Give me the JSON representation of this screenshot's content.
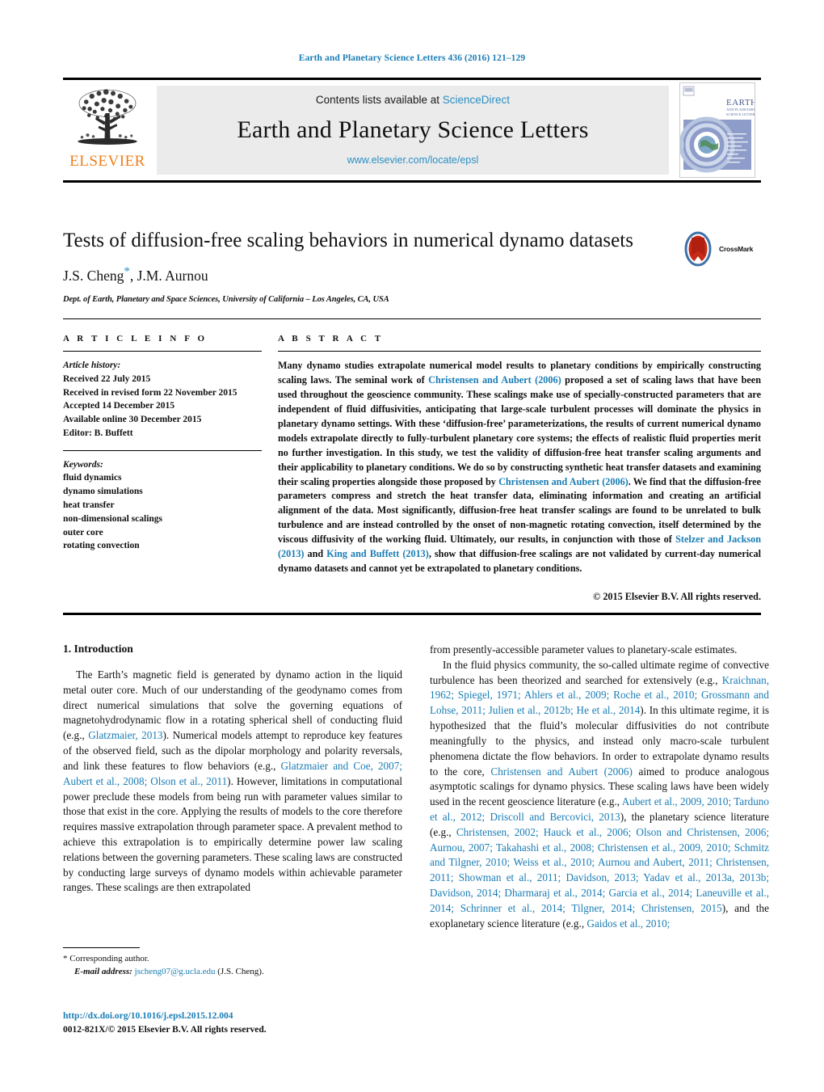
{
  "running_head": "Earth and Planetary Science Letters 436 (2016) 121–129",
  "masthead": {
    "contents_prefix": "Contents lists available at",
    "contents_link": "ScienceDirect",
    "journal_name": "Earth and Planetary Science Letters",
    "journal_url": "www.elsevier.com/locate/epsl",
    "publisher_wordmark": "ELSEVIER",
    "cover_title_line1": "EARTH",
    "cover_title_line2": "AND PLANETARY",
    "cover_title_line3": "SCIENCE LETTERS"
  },
  "title_block": {
    "title": "Tests of diffusion-free scaling behaviors in numerical dynamo datasets",
    "authors_part1": "J.S. Cheng",
    "corresponding_mark": "*",
    "authors_part2": ", J.M. Aurnou",
    "affiliation": "Dept. of Earth, Planetary and Space Sciences, University of California – Los Angeles, CA, USA",
    "crossmark_label": "CrossMark"
  },
  "article_info": {
    "heading": "A R T I C L E   I N F O",
    "history_label": "Article history:",
    "history": [
      "Received 22 July 2015",
      "Received in revised form 22 November 2015",
      "Accepted 14 December 2015",
      "Available online 30 December 2015",
      "Editor: B. Buffett"
    ],
    "keywords_label": "Keywords:",
    "keywords": [
      "fluid dynamics",
      "dynamo simulations",
      "heat transfer",
      "non-dimensional scalings",
      "outer core",
      "rotating convection"
    ]
  },
  "abstract": {
    "heading": "A B S T R A C T",
    "p1a": "Many dynamo studies extrapolate numerical model results to planetary conditions by empirically constructing scaling laws. The seminal work of ",
    "cite1": "Christensen and Aubert (2006)",
    "p1b": " proposed a set of scaling laws that have been used throughout the geoscience community. These scalings make use of specially-constructed parameters that are independent of fluid diffusivities, anticipating that large-scale turbulent processes will dominate the physics in planetary dynamo settings. With these ‘diffusion-free’ parameterizations, the results of current numerical dynamo models extrapolate directly to fully-turbulent planetary core systems; the effects of realistic fluid properties merit no further investigation. In this study, we test the validity of diffusion-free heat transfer scaling arguments and their applicability to planetary conditions. We do so by constructing synthetic heat transfer datasets and examining their scaling properties alongside those proposed by ",
    "cite2": "Christensen and Aubert (2006)",
    "p1c": ". We find that the diffusion-free parameters compress and stretch the heat transfer data, eliminating information and creating an artificial alignment of the data. Most significantly, diffusion-free heat transfer scalings are found to be unrelated to bulk turbulence and are instead controlled by the onset of non-magnetic rotating convection, itself determined by the viscous diffusivity of the working fluid. Ultimately, our results, in conjunction with those of ",
    "cite3": "Stelzer and Jackson (2013)",
    "p1d": " and ",
    "cite4": "King and Buffett (2013)",
    "p1e": ", show that diffusion-free scalings are not validated by current-day numerical dynamo datasets and cannot yet be extrapolated to planetary conditions.",
    "copyright": "© 2015 Elsevier B.V. All rights reserved."
  },
  "body": {
    "section_title": "1. Introduction",
    "left_p1a": "The Earth’s magnetic field is generated by dynamo action in the liquid metal outer core. Much of our understanding of the geodynamo comes from direct numerical simulations that solve the governing equations of magnetohydrodynamic flow in a rotating spherical shell of conducting fluid (e.g., ",
    "left_cite1": "Glatzmaier, 2013",
    "left_p1b": "). Numerical models attempt to reproduce key features of the observed field, such as the dipolar morphology and polarity reversals, and link these features to flow behaviors (e.g., ",
    "left_cite2": "Glatzmaier and Coe, 2007; Aubert et al., 2008; Olson et al., 2011",
    "left_p1c": "). However, limitations in computational power preclude these models from being run with parameter values similar to those that exist in the core. Applying the results of models to the core therefore requires massive extrapolation through parameter space. A prevalent method to achieve this extrapolation is to empirically determine power law scaling relations between the governing parameters. These scaling laws are constructed by conducting large surveys of dynamo models within achievable parameter ranges. These scalings are then extrapolated",
    "right_p0": "from presently-accessible parameter values to planetary-scale estimates.",
    "right_p1a": "In the fluid physics community, the so-called ultimate regime of convective turbulence has been theorized and searched for extensively (e.g., ",
    "right_cite1": "Kraichnan, 1962; Spiegel, 1971; Ahlers et al., 2009; Roche et al., 2010; Grossmann and Lohse, 2011; Julien et al., 2012b; He et al., 2014",
    "right_p1b": "). In this ultimate regime, it is hypothesized that the fluid’s molecular diffusivities do not contribute meaningfully to the physics, and instead only macro-scale turbulent phenomena dictate the flow behaviors. In order to extrapolate dynamo results to the core, ",
    "right_cite2": "Christensen and Aubert (2006)",
    "right_p1c": " aimed to produce analogous asymptotic scalings for dynamo physics. These scaling laws have been widely used in the recent geoscience literature (e.g., ",
    "right_cite3": "Aubert et al., 2009, 2010; Tarduno et al., 2012; Driscoll and Bercovici, 2013",
    "right_p1d": "), the planetary science literature (e.g., ",
    "right_cite4": "Christensen, 2002; Hauck et al., 2006; Olson and Christensen, 2006; Aurnou, 2007; Takahashi et al., 2008; Christensen et al., 2009, 2010; Schmitz and Tilgner, 2010; Weiss et al., 2010; Aurnou and Aubert, 2011; Christensen, 2011; Showman et al., 2011; Davidson, 2013; Yadav et al., 2013a, 2013b; Davidson, 2014; Dharmaraj et al., 2014; Garcia et al., 2014; Laneuville et al., 2014; Schrinner et al., 2014; Tilgner, 2014; Christensen, 2015",
    "right_p1e": "), and the exoplanetary science literature (e.g., ",
    "right_cite5": "Gaidos et al., 2010;"
  },
  "footnote": {
    "star": "*",
    "corresponding": "Corresponding author.",
    "email_label": "E-mail address:",
    "email": "jscheng07@g.ucla.edu",
    "email_suffix": "(J.S. Cheng)."
  },
  "doi_block": {
    "doi": "http://dx.doi.org/10.1016/j.epsl.2015.12.004",
    "issn": "0012-821X/© 2015 Elsevier B.V. All rights reserved."
  },
  "colors": {
    "link": "#1a7db5",
    "elsevier_orange": "#f07f1a",
    "masthead_bg": "#ebebeb"
  }
}
